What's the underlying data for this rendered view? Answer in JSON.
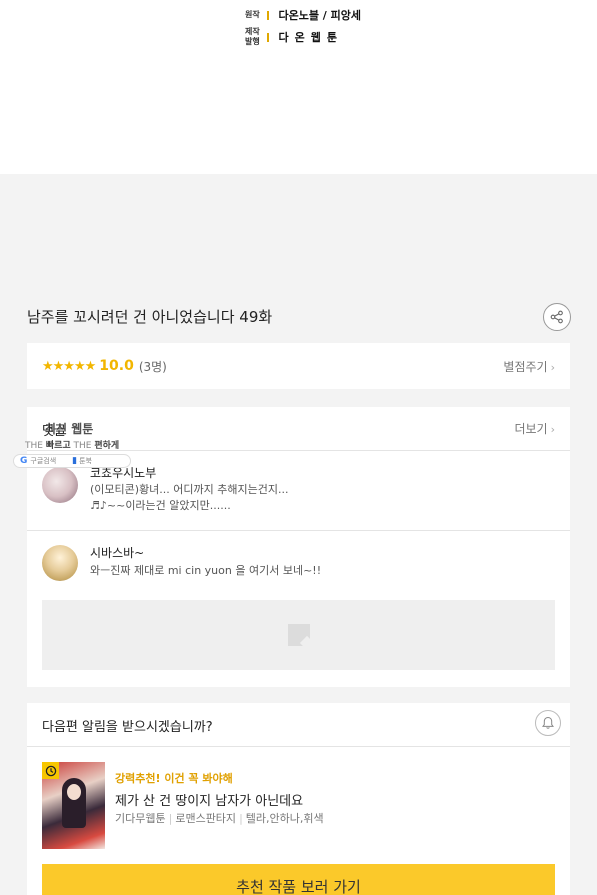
{
  "credits": {
    "rows": [
      {
        "key": "원작",
        "value": "다온노블 / 피앙세"
      },
      {
        "key_lines": [
          "제작",
          "발행"
        ],
        "value": "다온웹툰"
      }
    ]
  },
  "episode": {
    "title": "남주를 꼬시려던 건 아니었습니다 49화",
    "share_icon": "share-icon"
  },
  "rating": {
    "stars": "★★★★★",
    "score": "10.0",
    "votes": "(3명)",
    "rate_link": "별점주기",
    "star_color": "#f2b600"
  },
  "comments": {
    "heading": "댓글",
    "more": "더보기",
    "items": [
      {
        "user": "코쵸우시노부",
        "text_lines": [
          "(이모티콘)황녀... 어디까지 추해지는건지...",
          "♬♪~~이라는건 알았지만......"
        ]
      },
      {
        "user": "시바스바~",
        "text_lines": [
          "와ㅡ진짜 제대로 mi cin yuon 을 여기서 보네~!!"
        ]
      }
    ]
  },
  "widget": {
    "title": "최신 웹툰",
    "tagline_prefix": "THE",
    "tagline_bold1": "빠르고",
    "tagline_mid": "THE",
    "tagline_bold2": "편하게",
    "search_label": "구글검색",
    "bookmark_label": "툰북"
  },
  "notify": {
    "question": "다음편 알림을 받으시겠습니까?",
    "bell_icon": "bell-icon"
  },
  "recommendation": {
    "tag": "강력추천! 이건 꼭 봐야해",
    "title": "제가 산 건 땅이지 남자가 아닌데요",
    "meta": [
      "기다무웹툰",
      "로맨스판타지",
      "텔라,안하나,휘색"
    ],
    "button": "추천 작품 보러 가기",
    "accent": "#fbc92a"
  }
}
